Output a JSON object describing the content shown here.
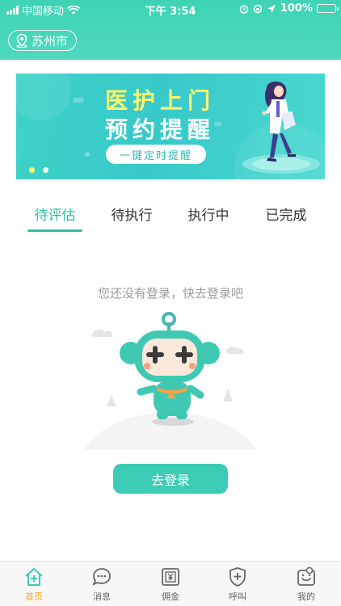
{
  "status_bar": {
    "carrier": "中国移动",
    "time": "下午 3:54",
    "battery": "100%"
  },
  "header": {
    "city": "苏州市"
  },
  "banner": {
    "title": "医护上门",
    "subtitle": "预约提醒",
    "button_label": "一键定时提醒",
    "slide_count": 2,
    "active_slide": 1
  },
  "tabs": [
    {
      "label": "待评估",
      "active": true
    },
    {
      "label": "待执行",
      "active": false
    },
    {
      "label": "执行中",
      "active": false
    },
    {
      "label": "已完成",
      "active": false
    }
  ],
  "empty_state": {
    "message": "您还没有登录，快去登录吧",
    "button_label": "去登录"
  },
  "tabbar": [
    {
      "label": "首页",
      "icon": "home-icon",
      "active": true
    },
    {
      "label": "消息",
      "icon": "message-icon",
      "active": false
    },
    {
      "label": "佣金",
      "icon": "commission-icon",
      "active": false
    },
    {
      "label": "呼叫",
      "icon": "call-shield-icon",
      "active": false
    },
    {
      "label": "我的",
      "icon": "profile-icon",
      "active": false
    }
  ],
  "colors": {
    "brand": "#3ccbb5",
    "active_tab": "#2fbfa8",
    "tabbar_active": "#f5a623",
    "banner_title": "#fff36b"
  }
}
